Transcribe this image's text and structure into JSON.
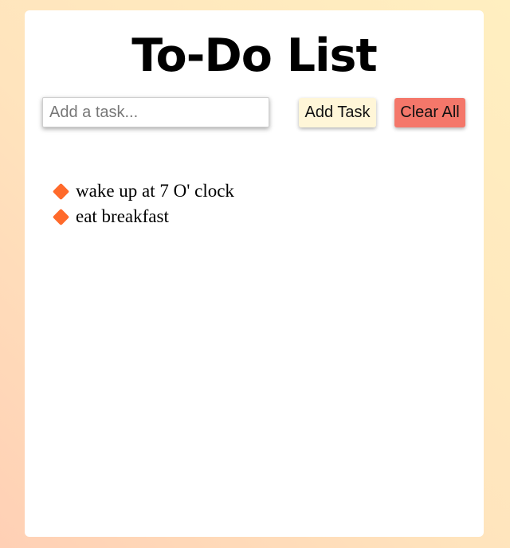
{
  "header": {
    "title": "To-Do List"
  },
  "input": {
    "placeholder": "Add a task...",
    "value": ""
  },
  "buttons": {
    "add_label": "Add Task",
    "clear_label": "Clear All"
  },
  "tasks": [
    {
      "text": "wake up at 7 O' clock",
      "icon": "diamond-bullet-icon"
    },
    {
      "text": "eat breakfast",
      "icon": "diamond-bullet-icon"
    }
  ],
  "colors": {
    "add_button_bg": "#fff6d8",
    "clear_button_bg": "#f4776a",
    "bullet": "#ff6a2b",
    "card_bg": "#ffffff"
  }
}
